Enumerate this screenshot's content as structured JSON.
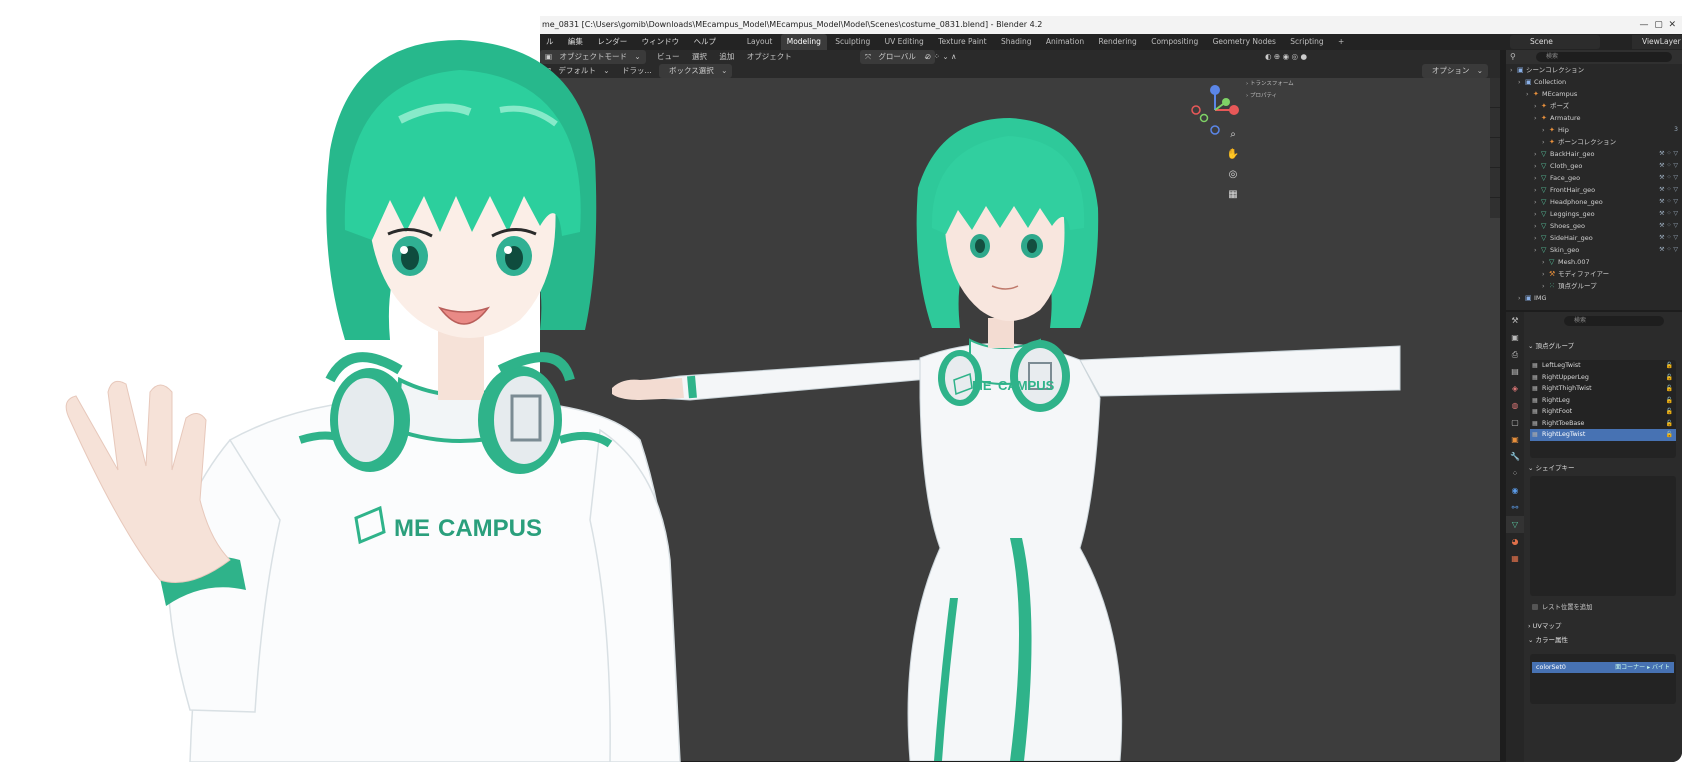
{
  "window": {
    "title": "me_0831 [C:\\Users\\gomib\\Downloads\\MEcampus_Model\\MEcampus_Model\\Model\\Scenes\\costume_0831.blend] - Blender 4.2"
  },
  "menu": {
    "items": [
      "ル",
      "編集",
      "レンダー",
      "ウィンドウ",
      "ヘルプ"
    ],
    "workspaces": [
      "Layout",
      "Modeling",
      "Sculpting",
      "UV Editing",
      "Texture Paint",
      "Shading",
      "Animation",
      "Rendering",
      "Compositing",
      "Geometry Nodes",
      "Scripting",
      "+"
    ],
    "active_workspace": "Modeling",
    "scene": "Scene",
    "view_layer": "ViewLayer"
  },
  "viewport_header": {
    "mode": "オブジェクトモード",
    "view": "ビュー",
    "select": "選択",
    "add": "追加",
    "object": "オブジェクト",
    "orientation": "グローバル",
    "default": "デフォルト",
    "drag": "ドラッ...",
    "box_select": "ボックス選択",
    "options": "オプション"
  },
  "n_panel": {
    "transform": "トランスフォーム",
    "properties": "プロパティ"
  },
  "outliner": {
    "search_placeholder": "検索",
    "rows": [
      {
        "label": "シーンコレクション",
        "depth": 0,
        "icon": "collection-icon"
      },
      {
        "label": "Collection",
        "depth": 1,
        "icon": "collection-icon"
      },
      {
        "label": "MEcampus",
        "depth": 2,
        "icon": "armature-icon"
      },
      {
        "label": "ポーズ",
        "depth": 3,
        "icon": "pose-icon"
      },
      {
        "label": "Armature",
        "depth": 3,
        "icon": "armature-icon"
      },
      {
        "label": "Hip",
        "depth": 4,
        "icon": "bone-icon"
      },
      {
        "label": "ボーンコレクション",
        "depth": 4,
        "icon": "bone-icon"
      },
      {
        "label": "BackHair_geo",
        "depth": 3,
        "icon": "mesh-icon"
      },
      {
        "label": "Cloth_geo",
        "depth": 3,
        "icon": "mesh-icon"
      },
      {
        "label": "Face_geo",
        "depth": 3,
        "icon": "mesh-icon"
      },
      {
        "label": "FrontHair_geo",
        "depth": 3,
        "icon": "mesh-icon"
      },
      {
        "label": "Headphone_geo",
        "depth": 3,
        "icon": "mesh-icon"
      },
      {
        "label": "Leggings_geo",
        "depth": 3,
        "icon": "mesh-icon"
      },
      {
        "label": "Shoes_geo",
        "depth": 3,
        "icon": "mesh-icon"
      },
      {
        "label": "SideHair_geo",
        "depth": 3,
        "icon": "mesh-icon"
      },
      {
        "label": "Skin_geo",
        "depth": 3,
        "icon": "mesh-icon"
      },
      {
        "label": "Mesh.007",
        "depth": 4,
        "icon": "mesh-data-icon"
      },
      {
        "label": "モディファイアー",
        "depth": 4,
        "icon": "wrench-icon"
      },
      {
        "label": "頂点グループ",
        "depth": 4,
        "icon": "vertex-group-icon"
      },
      {
        "label": "IMG",
        "depth": 1,
        "icon": "collection-icon"
      }
    ],
    "hip_count": "3"
  },
  "properties": {
    "search_placeholder": "検索",
    "vertex_groups_title": "頂点グループ",
    "vertex_groups": [
      "LeftLegTwist",
      "RightUpperLeg",
      "RightThighTwist",
      "RightLeg",
      "RightFoot",
      "RightToeBase",
      "RightLegTwist"
    ],
    "active_vertex_group": "RightLegTwist",
    "shape_keys_title": "シェイプキー",
    "rest_position": "レスト位置を追加",
    "uv_maps_title": "UVマップ",
    "color_attributes_title": "カラー属性",
    "color_attribute": "colorSet0",
    "color_attribute_meta": "面コーナー ▸ バイト"
  },
  "logo_text": {
    "me": "ME",
    "campus": "CAMPUS"
  },
  "colors": {
    "accent_green": "#2fb38a",
    "hair_green": "#2ec99a",
    "viewport_bg": "#3d3d3d",
    "selection_blue": "#4772b3"
  }
}
